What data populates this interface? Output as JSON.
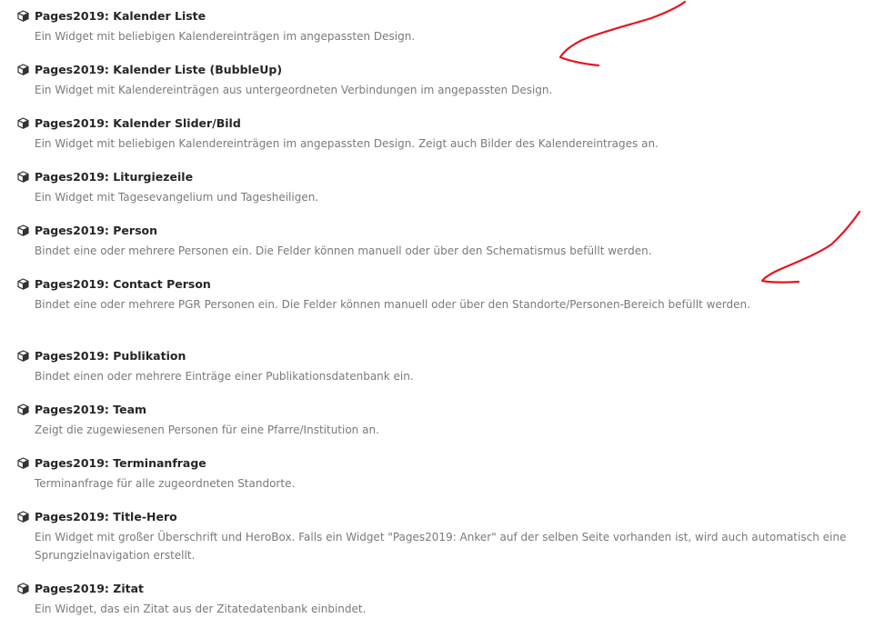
{
  "widgets": [
    {
      "title": "Pages2019: Kalender Liste",
      "description": "Ein Widget mit beliebigen Kalendereinträgen im angepassten Design."
    },
    {
      "title": "Pages2019: Kalender Liste (BubbleUp)",
      "description": "Ein Widget mit Kalendereinträgen aus untergeordneten Verbindungen im angepassten Design."
    },
    {
      "title": "Pages2019: Kalender Slider/Bild",
      "description": "Ein Widget mit beliebigen Kalendereinträgen im angepassten Design. Zeigt auch Bilder des Kalendereintrages an."
    },
    {
      "title": "Pages2019: Liturgiezeile",
      "description": "Ein Widget mit Tagesevangelium und Tagesheiligen."
    },
    {
      "title": "Pages2019: Person",
      "description": "Bindet eine oder mehrere Personen ein. Die Felder können manuell oder über den Schematismus befüllt werden."
    },
    {
      "title": "Pages2019: Contact Person",
      "description": "Bindet eine oder mehrere PGR Personen ein. Die Felder können manuell oder über den Standorte/Personen-Bereich befüllt werden."
    },
    {
      "title": "Pages2019: Publikation",
      "description": "Bindet einen oder mehrere Einträge einer Publikationsdatenbank ein."
    },
    {
      "title": "Pages2019: Team",
      "description": "Zeigt die zugewiesenen Personen für eine Pfarre/Institution an."
    },
    {
      "title": "Pages2019: Terminanfrage",
      "description": "Terminanfrage für alle zugeordneten Standorte."
    },
    {
      "title": "Pages2019: Title-Hero",
      "description": "Ein Widget mit großer Überschrift und HeroBox. Falls ein Widget \"Pages2019: Anker\" auf der selben Seite vorhanden ist, wird auch automatisch eine Sprungzielnavigation erstellt."
    },
    {
      "title": "Pages2019: Zitat",
      "description": "Ein Widget, das ein Zitat aus der Zitatedatenbank einbindet."
    }
  ],
  "icons": {
    "widget": "cube-icon"
  },
  "colors": {
    "title": "#262626",
    "description": "#7a7a7a",
    "annotation": "#e8141c"
  }
}
